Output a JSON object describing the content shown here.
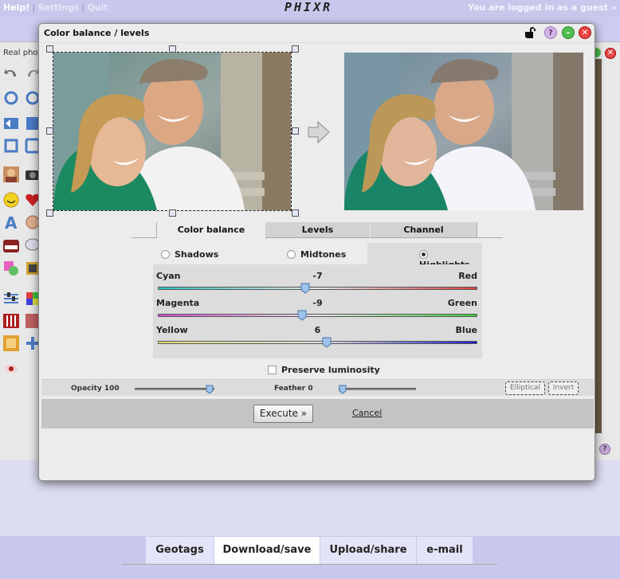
{
  "topbar": {
    "help": "Help!",
    "settings": "Settings",
    "quit": "Quit",
    "logo": "PHIXR",
    "login_status": "You are logged in as a guest »"
  },
  "background_app": {
    "title": "Real phot"
  },
  "dialog": {
    "title": "Color balance / levels",
    "help_icon_glyph": "?"
  },
  "tabs": [
    {
      "label": "Color balance",
      "active": true
    },
    {
      "label": "Levels",
      "active": false
    },
    {
      "label": "Channel",
      "active": false
    }
  ],
  "tone_ranges": [
    {
      "label": "Shadows",
      "selected": false
    },
    {
      "label": "Midtones",
      "selected": false
    },
    {
      "label": "Highlights",
      "selected": true
    }
  ],
  "sliders": [
    {
      "left_label": "Cyan",
      "right_label": "Red",
      "value": "-7",
      "position_pct": 46,
      "left_color": "#2ac4c4",
      "right_color": "#e04040"
    },
    {
      "left_label": "Magenta",
      "right_label": "Green",
      "value": "-9",
      "position_pct": 45,
      "left_color": "#d048d0",
      "right_color": "#3ccc3c"
    },
    {
      "left_label": "Yellow",
      "right_label": "Blue",
      "value": "6",
      "position_pct": 53,
      "left_color": "#e0e078",
      "right_color": "#1c1cc8"
    }
  ],
  "preserve_luminosity": {
    "label": "Preserve luminosity",
    "checked": false
  },
  "options": {
    "opacity_label": "Opacity 100",
    "opacity_value": 100,
    "feather_label": "Feather 0",
    "feather_value": 0,
    "elliptical_label": "Elliptical",
    "invert_label": "Invert"
  },
  "footer": {
    "execute_label": "Execute »",
    "cancel_label": "Cancel"
  },
  "bottom_nav": [
    {
      "label": "Geotags",
      "active": false
    },
    {
      "label": "Download/save",
      "active": true
    },
    {
      "label": "Upload/share",
      "active": false
    },
    {
      "label": "e-mail",
      "active": false
    }
  ]
}
